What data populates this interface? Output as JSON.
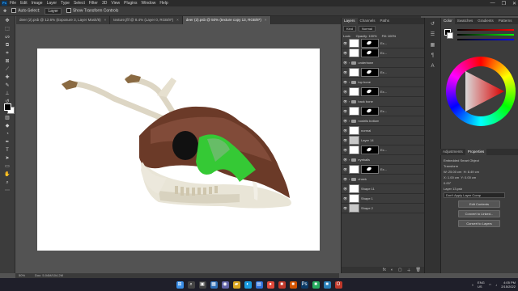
{
  "app": {
    "logo": "Ps"
  },
  "menu": [
    "File",
    "Edit",
    "Image",
    "Layer",
    "Type",
    "Select",
    "Filter",
    "3D",
    "View",
    "Plugins",
    "Window",
    "Help"
  ],
  "window_controls": [
    "—",
    "❐",
    "✕"
  ],
  "options_bar": {
    "auto_select_label": "Auto-Select:",
    "auto_select_value": "Layer",
    "transform_label": "Show Transform Controls"
  },
  "tabs": [
    {
      "label": "deer (2).psb @ 12.6% (Exposure 3, Layer Mask/8)",
      "active": false
    },
    {
      "label": "texture.jfif @ 8.4% (Layer 0, RGB/8*)",
      "active": false
    },
    {
      "label": "deer (2).psb @ 50% (texture copy 13, RGB/8*)",
      "active": true
    }
  ],
  "status": {
    "zoom": "50%",
    "doc": "Doc: 5.04M/104.2M"
  },
  "layers_panel": {
    "tabs": [
      "Layers",
      "Channels",
      "Paths"
    ],
    "search": "Kind",
    "blend": "Normal",
    "opacity": "Opacity: 100%",
    "lock": "Lock:",
    "fill": "Fill: 100%",
    "rows": [
      {
        "name": "Ex...",
        "thumb": "white",
        "mask": true,
        "visible": true
      },
      {
        "name": "Ex...",
        "thumb": "white",
        "mask": true,
        "visible": true
      },
      {
        "name": "underbone",
        "thumb": "folder",
        "mask": false,
        "visible": true
      },
      {
        "name": "Ex...",
        "thumb": "white",
        "mask": true,
        "visible": true
      },
      {
        "name": "top bone",
        "thumb": "folder",
        "mask": false,
        "visible": true
      },
      {
        "name": "Ex...",
        "thumb": "white",
        "mask": true,
        "visible": true
      },
      {
        "name": "back bone",
        "thumb": "folder",
        "mask": false,
        "visible": true
      },
      {
        "name": "Ex...",
        "thumb": "white",
        "mask": true,
        "visible": true
      },
      {
        "name": "nostrils bottom",
        "thumb": "folder",
        "mask": false,
        "visible": true
      },
      {
        "name": "normal",
        "thumb": "white",
        "mask": false,
        "visible": true
      },
      {
        "name": "Layer 14",
        "thumb": "grey",
        "mask": false,
        "visible": true
      },
      {
        "name": "Ex...",
        "thumb": "white",
        "mask": true,
        "visible": true
      },
      {
        "name": "eyeballs",
        "thumb": "folder",
        "mask": false,
        "visible": true
      },
      {
        "name": "Ex...",
        "thumb": "white",
        "mask": true,
        "visible": true
      },
      {
        "name": "cheek",
        "thumb": "folder",
        "mask": false,
        "visible": true
      },
      {
        "name": "Shape 11",
        "thumb": "white",
        "mask": false,
        "visible": true
      },
      {
        "name": "Shape 1",
        "thumb": "white",
        "mask": false,
        "visible": true
      },
      {
        "name": "Shape 2",
        "thumb": "grey",
        "mask": false,
        "visible": true
      }
    ],
    "bottom_icons": [
      "fx",
      "◐",
      "▢",
      "＋",
      "🗑"
    ]
  },
  "color_panel": {
    "tabs": [
      "Color",
      "Swatches",
      "Gradients",
      "Patterns"
    ]
  },
  "properties_panel": {
    "tabs": [
      "Adjustments",
      "Properties"
    ],
    "type": "Embedded Smart Object",
    "transform_label": "Transform",
    "w": "W: 25.00 cm",
    "h": "H: 8.49 cm",
    "x": "X: 1.00 cm",
    "y": "Y: 0.00 cm",
    "angle": "0.00°",
    "layer_comp": "Layer 13.psb",
    "layer_comp_placeholder": "Don't Apply Layer Comp",
    "buttons": [
      "Edit Contents",
      "Convert to Linked...",
      "Convert to Layers"
    ]
  },
  "taskbar": {
    "apps": [
      {
        "name": "windows-start",
        "glyph": "⊞",
        "color": "#3a8ee6"
      },
      {
        "name": "search",
        "glyph": "⌕",
        "color": "#444"
      },
      {
        "name": "task-view",
        "glyph": "▣",
        "color": "#444"
      },
      {
        "name": "widgets",
        "glyph": "▦",
        "color": "#2f6fb5"
      },
      {
        "name": "chat",
        "glyph": "◉",
        "color": "#6264a7"
      },
      {
        "name": "explorer",
        "glyph": "▰",
        "color": "#d9a520"
      },
      {
        "name": "edge",
        "glyph": "◐",
        "color": "#1a9be0"
      },
      {
        "name": "store",
        "glyph": "▤",
        "color": "#2e6fd6"
      },
      {
        "name": "chrome",
        "glyph": "●",
        "color": "#e04a3b"
      },
      {
        "name": "app-red",
        "glyph": "■",
        "color": "#c0392b"
      },
      {
        "name": "app-orange",
        "glyph": "■",
        "color": "#d35400"
      },
      {
        "name": "photoshop",
        "glyph": "Ps",
        "color": "#0b3a66"
      },
      {
        "name": "app-green",
        "glyph": "■",
        "color": "#27ae60"
      },
      {
        "name": "app-blue",
        "glyph": "■",
        "color": "#2980b9"
      },
      {
        "name": "opera",
        "glyph": "O",
        "color": "#c0392b"
      }
    ],
    "tray": {
      "lang": "ENG\nUS",
      "time": "4:05 PM",
      "date": "2/15/2022"
    }
  },
  "colors": {
    "fg": "#000000",
    "bg": "#ffffff",
    "accent_green": "#35c935",
    "bone": "#e7e3d4",
    "fur": "#6b3a28"
  }
}
